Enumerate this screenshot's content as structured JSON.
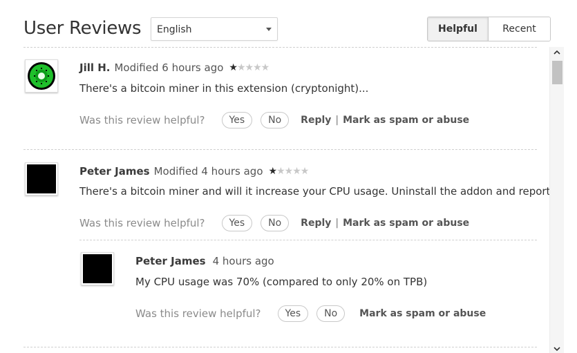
{
  "header": {
    "title": "User Reviews",
    "language_selected": "English",
    "sort_tabs": [
      {
        "label": "Helpful",
        "active": true
      },
      {
        "label": "Recent",
        "active": false
      }
    ]
  },
  "helpful_prompt": "Was this review helpful?",
  "reviews": [
    {
      "author": "Jill H.",
      "modified": "Modified 6 hours ago",
      "rating": 1,
      "max_rating": 5,
      "text": "There's a bitcoin miner in this extension (cryptonight)...",
      "avatar_icon": "kiwi-avatar-icon",
      "actions": {
        "yes": "Yes",
        "no": "No",
        "reply": "Reply",
        "separator": "|",
        "spam": "Mark as spam or abuse"
      }
    },
    {
      "author": "Peter James",
      "modified": "Modified 4 hours ago",
      "rating": 1,
      "max_rating": 5,
      "text": "There's a bitcoin miner and will it increase your CPU usage. Uninstall the addon and report it.",
      "avatar_icon": "black-square-avatar-icon",
      "actions": {
        "yes": "Yes",
        "no": "No",
        "reply": "Reply",
        "separator": "|",
        "spam": "Mark as spam or abuse"
      },
      "replies": [
        {
          "author": "Peter James",
          "modified": "4 hours ago",
          "text": "My CPU usage was 70% (compared to only 20% on TPB)",
          "avatar_icon": "black-square-avatar-icon",
          "actions": {
            "yes": "Yes",
            "no": "No",
            "spam": "Mark as spam or abuse"
          }
        }
      ]
    }
  ],
  "star_glyph": "★",
  "scrollbar": {
    "up_icon": "chevron-up-icon",
    "down_icon": "chevron-down-icon"
  }
}
